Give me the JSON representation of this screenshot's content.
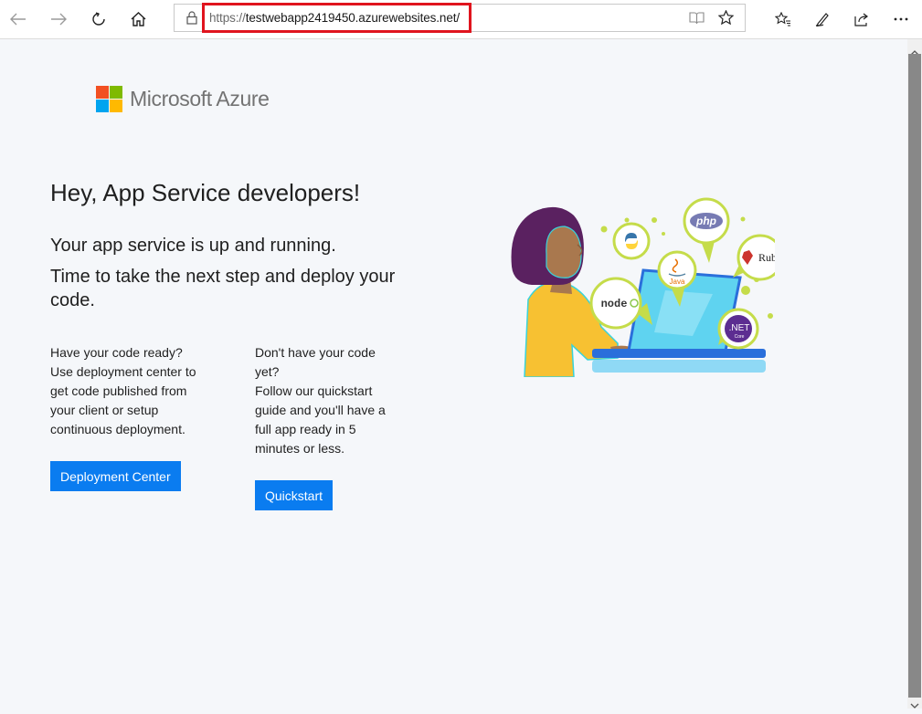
{
  "browser": {
    "url_scheme": "https://",
    "url_host": "testwebapp2419450.azurewebsites.net/",
    "icons": {
      "back": "back-arrow-icon",
      "forward": "forward-arrow-icon",
      "refresh": "refresh-icon",
      "home": "home-icon",
      "lock": "lock-icon",
      "reading_view": "reading-view-icon",
      "favorite": "star-icon",
      "favorites_hub": "favorites-icon",
      "notes": "pen-icon",
      "share": "share-icon",
      "more": "more-icon"
    }
  },
  "page": {
    "logo_text": "Microsoft Azure",
    "headline": "Hey, App Service developers!",
    "subheading_line1": "Your app service is up and running.",
    "subheading_line2": "Time to take the next step and deploy your code.",
    "col1": {
      "lines": [
        "Have your code ready?",
        "Use deployment center to",
        "get code published from",
        "your client or setup",
        "continuous deployment."
      ],
      "button": "Deployment Center"
    },
    "col2": {
      "lines": [
        "Don't have your code",
        "yet?",
        "Follow our quickstart",
        "guide and you'll have a",
        "full app ready in 5",
        "minutes or less."
      ],
      "button": "Quickstart"
    },
    "illustration": {
      "bubbles": [
        "php",
        "Ruby",
        "node",
        "Java",
        ".NET",
        "Core"
      ]
    }
  },
  "colors": {
    "accent_button": "#0a7cf0",
    "highlight_box": "#e0141e",
    "page_bg": "#f5f7fa",
    "logo_red": "#f25022",
    "logo_green": "#7fba00",
    "logo_blue": "#00a4ef",
    "logo_yellow": "#ffb900"
  }
}
